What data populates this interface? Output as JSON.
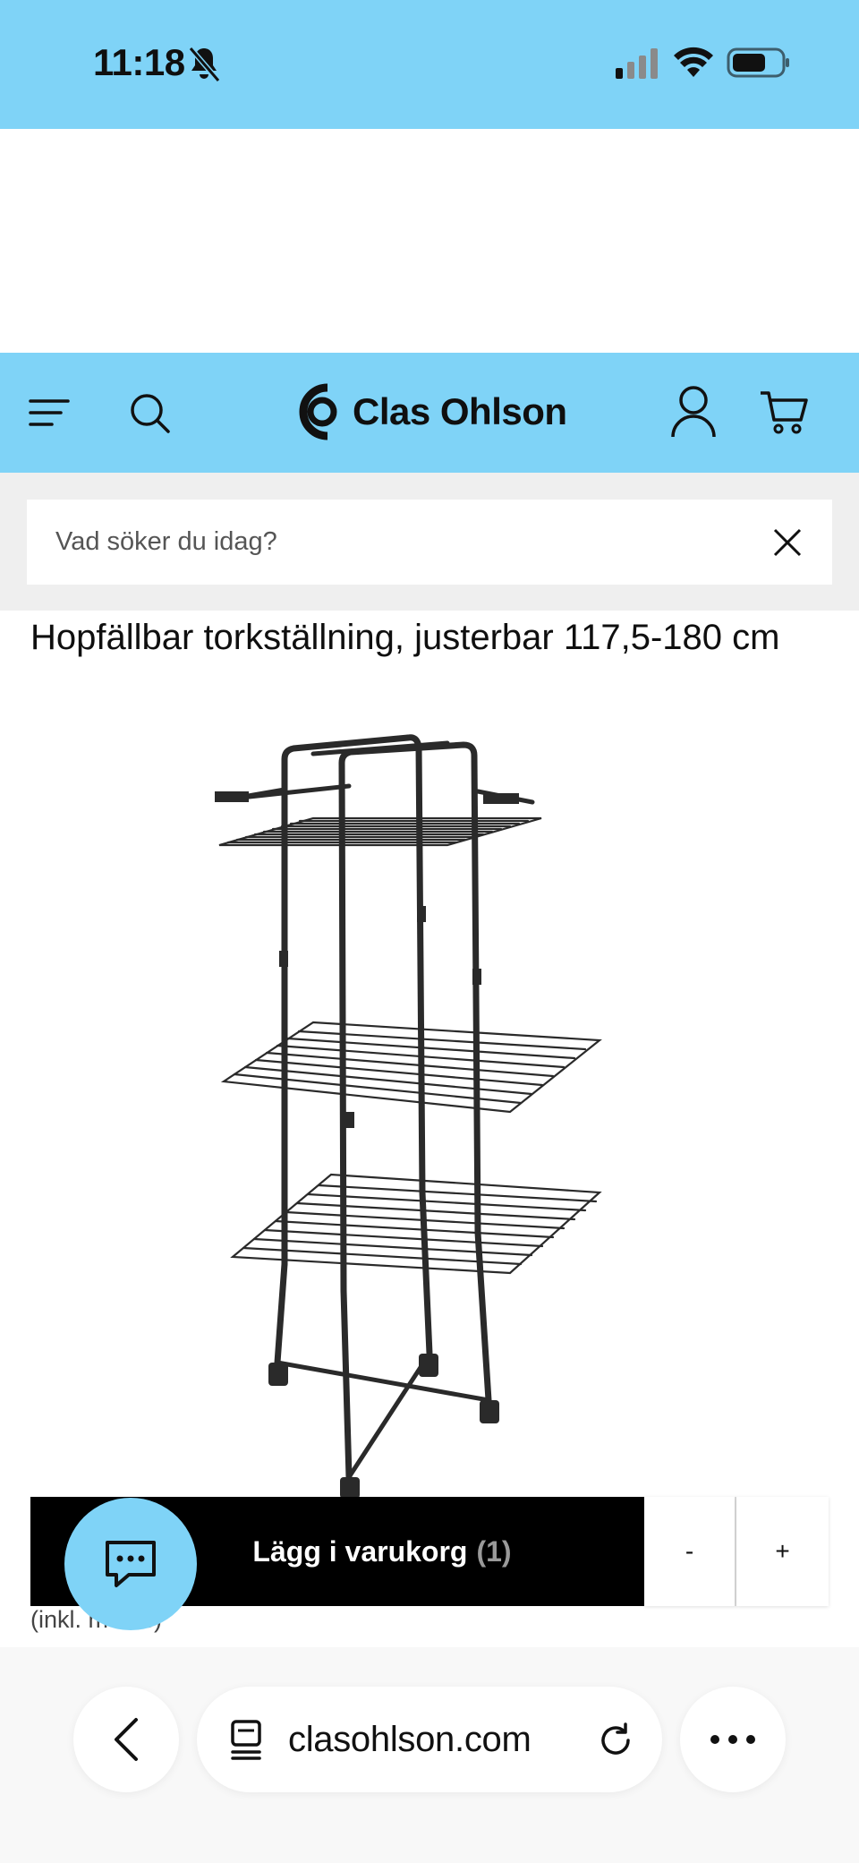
{
  "status_bar": {
    "time": "11:18",
    "icons": [
      "bell-slash-icon",
      "cellular-signal-icon",
      "wifi-icon",
      "battery-icon"
    ],
    "background": "#7fd3f7"
  },
  "header": {
    "brand": "Clas Ohlson",
    "icons": [
      "menu-icon",
      "search-icon",
      "logo-icon",
      "account-icon",
      "cart-icon"
    ],
    "background": "#7fd3f7"
  },
  "search": {
    "placeholder": "Vad söker du idag?",
    "value": "",
    "clear_icon": "close-icon"
  },
  "product": {
    "title": "Hopfällbar torkställning, justerbar 117,5-180 cm",
    "image_icon": "drying-rack-image"
  },
  "purchase": {
    "add_to_cart_label": "Lägg i varukorg",
    "cart_count": "(1)",
    "minus_label": "-",
    "plus_label": "+",
    "price_note": "(inkl. moms)"
  },
  "chat": {
    "icon": "chat-bubble-icon",
    "color": "#7fd3f7"
  },
  "browser": {
    "url": "clasohlson.com",
    "icons": [
      "back-chevron-icon",
      "tabs-icon",
      "reload-icon",
      "more-icon"
    ]
  }
}
